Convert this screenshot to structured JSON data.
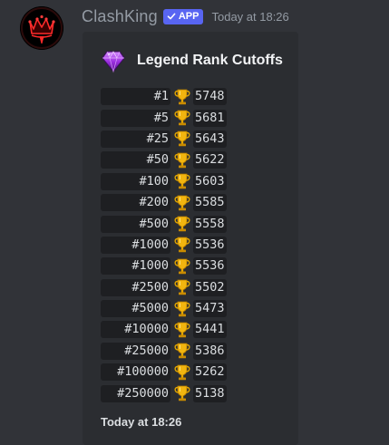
{
  "message": {
    "username": "ClashKing",
    "badge": "APP",
    "timestamp": "Today at 18:26",
    "avatar_icon": "crown-icon"
  },
  "embed": {
    "title": "Legend Rank Cutoffs",
    "title_icon": "purple-gem-icon",
    "row_icon": "trophy-icon",
    "rows": [
      {
        "rank": "#1",
        "trophies": "5748"
      },
      {
        "rank": "#5",
        "trophies": "5681"
      },
      {
        "rank": "#25",
        "trophies": "5643"
      },
      {
        "rank": "#50",
        "trophies": "5622"
      },
      {
        "rank": "#100",
        "trophies": "5603"
      },
      {
        "rank": "#200",
        "trophies": "5585"
      },
      {
        "rank": "#500",
        "trophies": "5558"
      },
      {
        "rank": "#1000",
        "trophies": "5536"
      },
      {
        "rank": "#1000",
        "trophies": "5536"
      },
      {
        "rank": "#2500",
        "trophies": "5502"
      },
      {
        "rank": "#5000",
        "trophies": "5473"
      },
      {
        "rank": "#10000",
        "trophies": "5441"
      },
      {
        "rank": "#25000",
        "trophies": "5386"
      },
      {
        "rank": "#100000",
        "trophies": "5262"
      },
      {
        "rank": "#250000",
        "trophies": "5138"
      }
    ],
    "footer": "Today at 18:26"
  },
  "colors": {
    "background": "#313338",
    "embed_background": "#2b2d31",
    "code_background": "#1e1f22",
    "badge": "#5865f2",
    "muted_text": "#949ba4",
    "text": "#dbdee1"
  }
}
